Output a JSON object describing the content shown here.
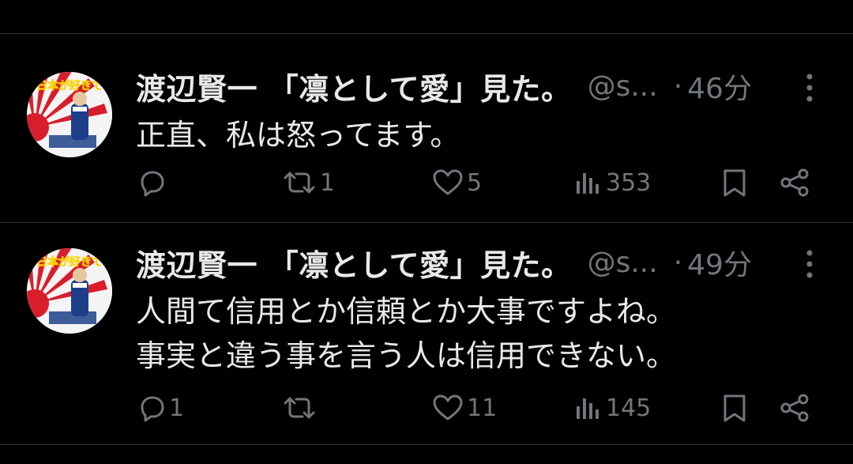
{
  "tweets": [
    {
      "name": "渡辺賢一 「凛として愛」見た。",
      "handle": "@s...",
      "separator": "·",
      "time": "46分",
      "text_lines": [
        "正直、私は怒ってます。"
      ],
      "counts": {
        "reply": "",
        "retweet": "1",
        "like": "5",
        "views": "353"
      },
      "avatar_text": "日本が好きで"
    },
    {
      "name": "渡辺賢一 「凛として愛」見た。",
      "handle": "@s...",
      "separator": "·",
      "time": "49分",
      "text_lines": [
        "人間て信用とか信頼とか大事ですよね。",
        "事実と違う事を言う人は信用できない。"
      ],
      "counts": {
        "reply": "1",
        "retweet": "",
        "like": "11",
        "views": "145"
      },
      "avatar_text": "日本が好きで"
    }
  ],
  "icons": {
    "reply": "reply-icon",
    "retweet": "retweet-icon",
    "like": "heart-icon",
    "views": "views-icon",
    "bookmark": "bookmark-icon",
    "share": "share-icon",
    "more": "more-icon"
  },
  "colors": {
    "background": "#000000",
    "primary_text": "#e7e9ea",
    "secondary_text": "#71767b",
    "divider": "#2f3336"
  }
}
